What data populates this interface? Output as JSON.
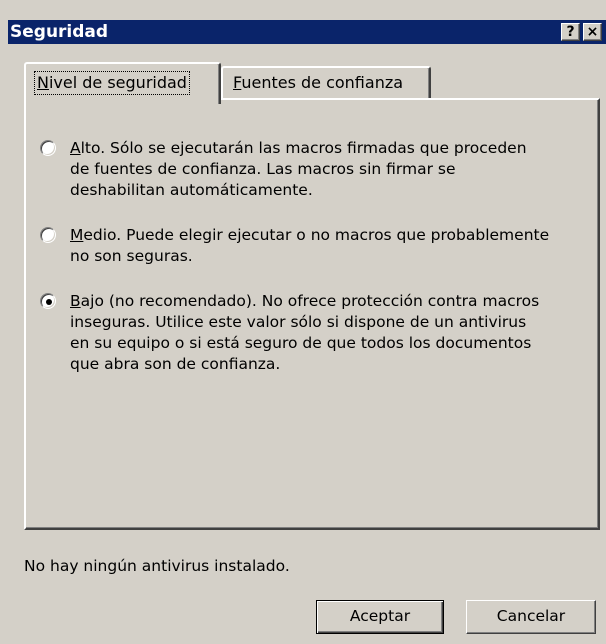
{
  "window": {
    "title": "Seguridad",
    "help_label": "?",
    "close_label": "×"
  },
  "tabs": [
    {
      "label": "Nivel de seguridad",
      "mnemonic": "N",
      "rest": "ivel de seguridad",
      "active": true
    },
    {
      "label": "Fuentes de confianza",
      "mnemonic": "F",
      "rest": "uentes de confianza",
      "active": false
    }
  ],
  "options": [
    {
      "label": "Alto. Sólo se ejecutarán las macros firmadas que proceden de fuentes de confianza. Las macros sin firmar se deshabilitan automáticamente.",
      "mnemonic": "A",
      "rest": "lto. Sólo se ejecutarán las macros firmadas que proceden de fuentes de confianza. Las macros sin firmar se deshabilitan automáticamente.",
      "selected": false
    },
    {
      "label": "Medio. Puede elegir ejecutar o no macros que probablemente no son seguras.",
      "mnemonic": "M",
      "rest": "edio. Puede elegir ejecutar o no macros que probablemente no son seguras.",
      "selected": false
    },
    {
      "label": "Bajo (no recomendado). No ofrece protección contra macros inseguras. Utilice este valor sólo si dispone de un antivirus en su equipo o si está seguro de que todos los documentos que abra son de confianza.",
      "mnemonic": "B",
      "rest": "ajo (no recomendado). No ofrece protección contra macros inseguras. Utilice este valor sólo si dispone de un antivirus en su equipo o si está seguro de que todos los documentos que abra son de confianza.",
      "selected": true
    }
  ],
  "status": "No hay ningún antivirus instalado.",
  "buttons": {
    "ok_label": "Aceptar",
    "cancel_label": "Cancelar"
  },
  "colors": {
    "titlebar": "#0a246a",
    "dialog_face": "#d4d0c8"
  }
}
